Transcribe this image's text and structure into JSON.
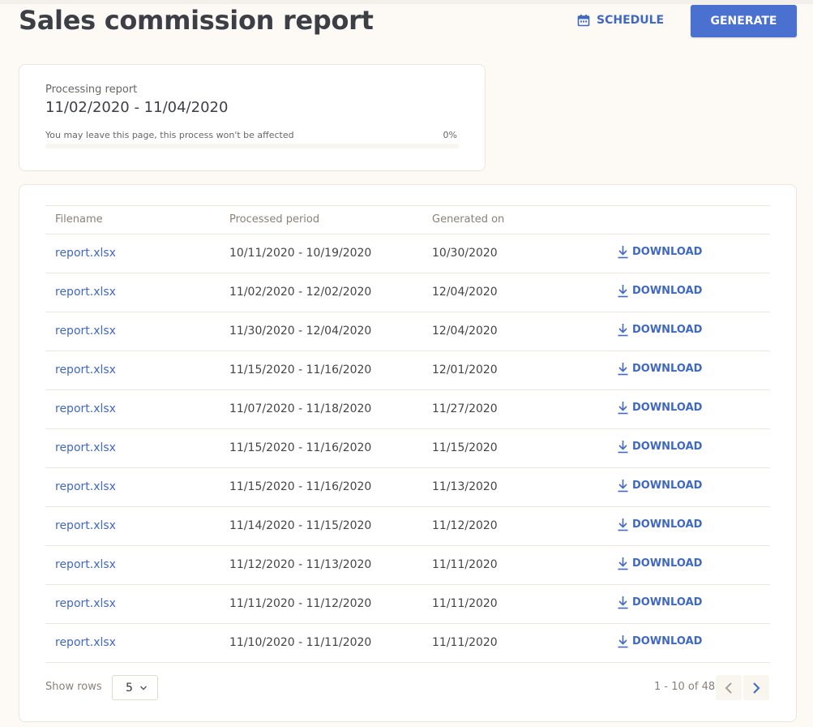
{
  "header": {
    "title": "Sales commission report",
    "schedule_label": "SCHEDULE",
    "generate_label": "GENERATE"
  },
  "processing": {
    "label": "Processing report",
    "range": "11/02/2020 - 11/04/2020",
    "note": "You may leave this page, this process won't be affected",
    "percent_text": "0%",
    "progress": 0
  },
  "table": {
    "columns": [
      "Filename",
      "Processed period",
      "Generated on",
      ""
    ],
    "download_label": "DOWNLOAD",
    "rows": [
      {
        "filename": "report.xlsx",
        "period": "10/11/2020 - 10/19/2020",
        "generated": "10/30/2020"
      },
      {
        "filename": "report.xlsx",
        "period": "11/02/2020 - 12/02/2020",
        "generated": "12/04/2020"
      },
      {
        "filename": "report.xlsx",
        "period": "11/30/2020 - 12/04/2020",
        "generated": "12/04/2020"
      },
      {
        "filename": "report.xlsx",
        "period": "11/15/2020 - 11/16/2020",
        "generated": "12/01/2020"
      },
      {
        "filename": "report.xlsx",
        "period": "11/07/2020 - 11/18/2020",
        "generated": "11/27/2020"
      },
      {
        "filename": "report.xlsx",
        "period": "11/15/2020 - 11/16/2020",
        "generated": "11/15/2020"
      },
      {
        "filename": "report.xlsx",
        "period": "11/15/2020 - 11/16/2020",
        "generated": "11/13/2020"
      },
      {
        "filename": "report.xlsx",
        "period": "11/14/2020 - 11/15/2020",
        "generated": "11/12/2020"
      },
      {
        "filename": "report.xlsx",
        "period": "11/12/2020 - 11/13/2020",
        "generated": "11/11/2020"
      },
      {
        "filename": "report.xlsx",
        "period": "11/11/2020 - 11/12/2020",
        "generated": "11/11/2020"
      },
      {
        "filename": "report.xlsx",
        "period": "11/10/2020 - 11/11/2020",
        "generated": "11/11/2020"
      }
    ]
  },
  "footer": {
    "show_rows_label": "Show rows",
    "rows_value": "5",
    "page_info": "1 - 10 of 48"
  },
  "icons": {
    "schedule": "calendar-icon",
    "download": "download-icon",
    "select": "chevron-down-icon",
    "prev": "chevron-left-icon",
    "next": "chevron-right-icon"
  },
  "colors": {
    "accent": "#4a70d0",
    "link": "#3f68c4",
    "background": "#fdfaf5"
  }
}
